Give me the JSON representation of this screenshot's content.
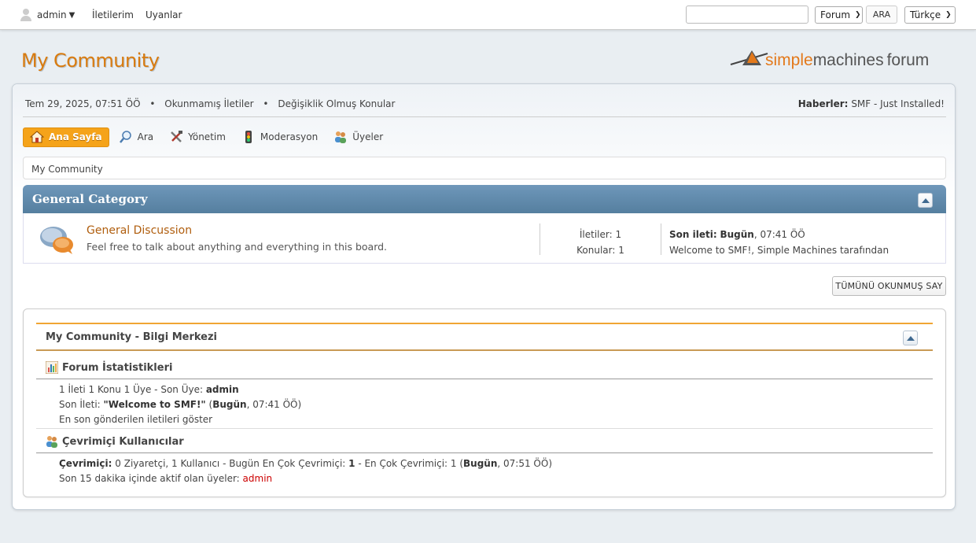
{
  "topbar": {
    "user": "admin",
    "messages": "İletilerim",
    "alerts": "Uyanlar",
    "search_value": "",
    "search_scope": "Forum",
    "search_button": "ARA",
    "language": "Türkçe"
  },
  "header": {
    "forum_title": "My Community",
    "logo_simple": "simple",
    "logo_machines": "machines",
    "logo_forum": "forum"
  },
  "info": {
    "datetime": "Tem 29, 2025, 07:51 ÖÖ",
    "unread": "Okunmamış İletiler",
    "updated": "Değişiklik Olmuş Konular",
    "news_label": "Haberler:",
    "news_text": "SMF - Just Installed!"
  },
  "menu": {
    "home": "Ana Sayfa",
    "search": "Ara",
    "admin": "Yönetim",
    "moderation": "Moderasyon",
    "members": "Üyeler"
  },
  "linktree": "My Community",
  "category": {
    "title": "General Category",
    "board": {
      "name": "General Discussion",
      "description": "Feel free to talk about anything and everything in this board.",
      "posts": "İletiler: 1",
      "topics": "Konular: 1",
      "last_post_label": "Son ileti:",
      "last_post_when": "Bugün",
      "last_post_time": ", 07:41 ÖÖ",
      "last_post_subject": "Welcome to SMF!, Simple Machines tarafından"
    }
  },
  "mark_read_button": "TÜMÜNÜ OKUNMUŞ SAY",
  "info_center": {
    "title": "My Community - Bilgi Merkezi",
    "stats_title": "Forum İstatistikleri",
    "stats_line1_prefix": "1 İleti 1 Konu 1 Üye - Son Üye: ",
    "stats_line1_member": "admin",
    "stats_line2_prefix": "Son İleti: ",
    "stats_line2_subject": "\"Welcome to SMF!\"",
    "stats_line2_paren_open": " (",
    "stats_line2_today": "Bugün",
    "stats_line2_time": ", 07:41 ÖÖ)",
    "stats_line3": "En son gönderilen iletileri göster",
    "online_title": "Çevrimiçi Kullanıcılar",
    "online_label": "Çevrimiçi:",
    "online_counts": " 0 Ziyaretçi, 1 Kullanıcı  - Bugün En Çok Çevrimiçi: ",
    "online_today_max": "1",
    "online_mid": " -  En Çok Çevrimiçi: 1 (",
    "online_today": "Bugün",
    "online_max_time": ", 07:51 ÖÖ)",
    "online_active_prefix": "Son 15 dakika içinde aktif olan üyeler: ",
    "online_active_user": "admin"
  }
}
